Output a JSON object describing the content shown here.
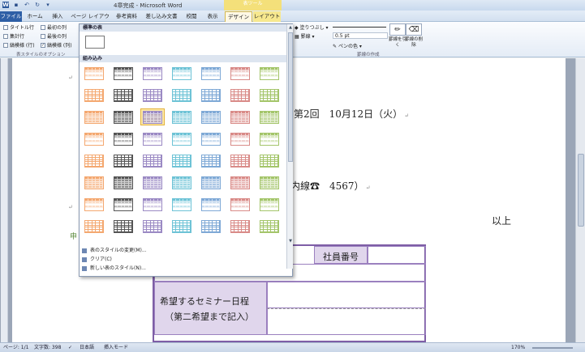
{
  "window": {
    "title": "4章完成 - Microsoft Word",
    "context_group": "表ツール"
  },
  "tabs": [
    "ファイル",
    "ホーム",
    "挿入",
    "ページ レイアウト",
    "参考資料",
    "差し込み文書",
    "校閲",
    "表示",
    "デザイン",
    "レイアウト"
  ],
  "ribbon": {
    "options": {
      "header_row": "タイトル行",
      "first_column": "最初の列",
      "total_row": "集計行",
      "last_column": "最後の列",
      "banded_rows": "縞模様 (行)",
      "banded_columns": "縞模様 (列)",
      "group_label": "表スタイルのオプション"
    },
    "shading": "塗りつぶし",
    "borders": "罫線",
    "pen_weight": "0.5 pt",
    "pen_color": "ペンの色",
    "draw_table": "罫線を引く",
    "eraser": "罫線の削除",
    "draw_group_label": "罫線の作成"
  },
  "gallery": {
    "plain_header": "標準の表",
    "builtin_header": "組み込み",
    "menu": {
      "modify": "表のスタイルの変更(M)...",
      "clear": "クリア(C)",
      "new": "新しい表のスタイル(N)..."
    },
    "column_colors": [
      "#f4a870",
      "#555555",
      "#9b8ac4",
      "#6ec3d6",
      "#7fa9d6",
      "#d98b88",
      "#a4c56a"
    ]
  },
  "document": {
    "date_line": "第2回　10月12日（火）",
    "ext_line": "内線☎　4567）",
    "closing": "以上",
    "side_mark": "申",
    "employee_no": "社員番号",
    "seminar_label_1": "希望するセミナー日程",
    "seminar_label_2": "（第二希望まで記入）"
  },
  "status": {
    "page": "ページ: 1/1",
    "words": "文字数: 398",
    "lang": "日本語",
    "mode": "挿入モード",
    "zoom": "170%"
  }
}
